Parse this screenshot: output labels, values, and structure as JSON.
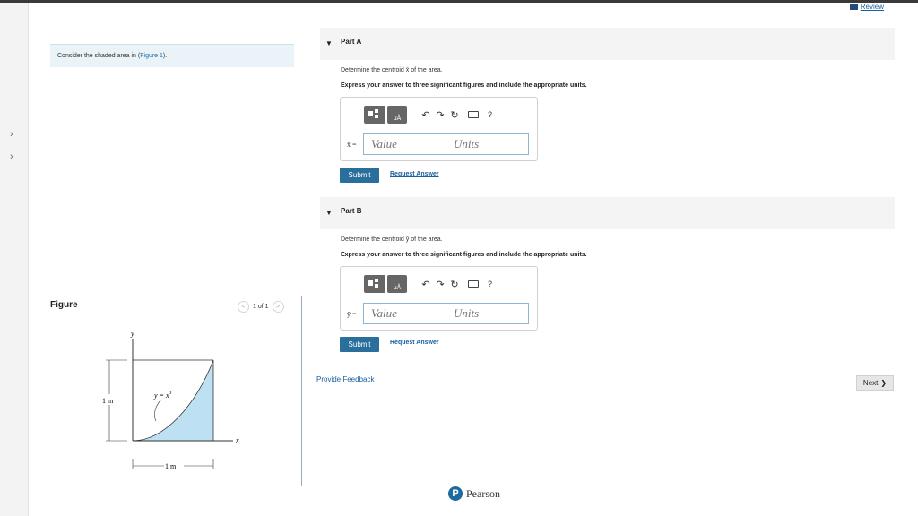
{
  "header": {
    "review_label": "Review"
  },
  "problem": {
    "text": "Consider the shaded area in (",
    "figure_link": "Figure 1",
    "text_end": ")."
  },
  "figure": {
    "title": "Figure",
    "pager_text": "1 of 1",
    "labels": {
      "y_axis": "y",
      "x_axis": "x",
      "curve": "y = x",
      "exponent": "3",
      "height": "1 m",
      "width": "1 m"
    },
    "fill_color": "#bde0f3"
  },
  "part_a": {
    "title": "Part A",
    "question": "Determine the centroid x̄ of the area.",
    "instruction": "Express your answer to three significant figures and include the appropriate units.",
    "var_label": "x̄ =",
    "value_placeholder": "Value",
    "units_placeholder": "Units",
    "submit_label": "Submit",
    "request_label": "Request Answer"
  },
  "part_b": {
    "title": "Part B",
    "question": "Determine the centroid ȳ of the area.",
    "instruction": "Express your answer to three significant figures and include the appropriate units.",
    "var_label": "ȳ =",
    "value_placeholder": "Value",
    "units_placeholder": "Units",
    "submit_label": "Submit",
    "request_label": "Request Answer"
  },
  "toolbar": {
    "mu_label": "μÅ",
    "help_label": "?"
  },
  "footer": {
    "feedback_label": "Provide Feedback",
    "next_label": "Next",
    "brand": "Pearson",
    "brand_initial": "P"
  }
}
